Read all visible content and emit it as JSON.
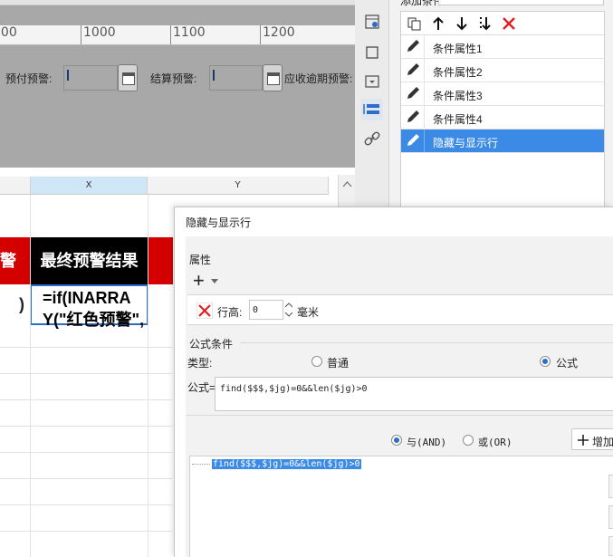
{
  "ruler": {
    "ticks": [
      "000",
      "1000",
      "1100",
      "1200"
    ]
  },
  "form_row": {
    "labels": [
      "预付预警:",
      "结算预警:",
      "应收逾期预警:"
    ]
  },
  "sheet": {
    "col_headers": [
      "X",
      "Y"
    ],
    "header_left_partial": "警",
    "header_cell": "最终预警结果",
    "left_cell_partial": ")",
    "formula_cell_lines": [
      "=if(INARRA",
      "Y(\"红色预警\","
    ]
  },
  "panel": {
    "title_partial": "添加条件",
    "toolbar_icons": [
      "copy-icon",
      "arrow-up-icon",
      "arrow-down-icon",
      "move-bottom-icon",
      "delete-icon"
    ],
    "items": [
      {
        "label": "条件属性1",
        "selected": false
      },
      {
        "label": "条件属性2",
        "selected": false
      },
      {
        "label": "条件属性3",
        "selected": false
      },
      {
        "label": "条件属性4",
        "selected": false
      },
      {
        "label": "隐藏与显示行",
        "selected": true
      }
    ],
    "side_icons": [
      "template-icon",
      "rectangle-icon",
      "dropdown-icon",
      "condition-icon",
      "link-icon"
    ]
  },
  "dialog": {
    "title": "隐藏与显示行",
    "attribute_label": "属性",
    "add_symbol": "+",
    "row_height_label": "行高:",
    "row_height_value": "0",
    "unit": "毫米",
    "formula_condition_label": "公式条件",
    "type_label": "类型:",
    "type_options": [
      {
        "label": "普通",
        "selected": false
      },
      {
        "label": "公式",
        "selected": true
      }
    ],
    "formula_label": "公式=",
    "formula_value": "find($$$,$jg)=0&&len($jg)>0",
    "logic_options": [
      {
        "label": "与(AND)",
        "selected": true
      },
      {
        "label": "或(OR)",
        "selected": false
      }
    ],
    "add_button": "增加",
    "condition_list": [
      "find($$$,$jg)=0&&len($jg)>0"
    ]
  },
  "colors": {
    "accent": "#3b8be6",
    "header_black": "#000000",
    "header_red": "#d40000",
    "delete_red": "#e02020"
  }
}
